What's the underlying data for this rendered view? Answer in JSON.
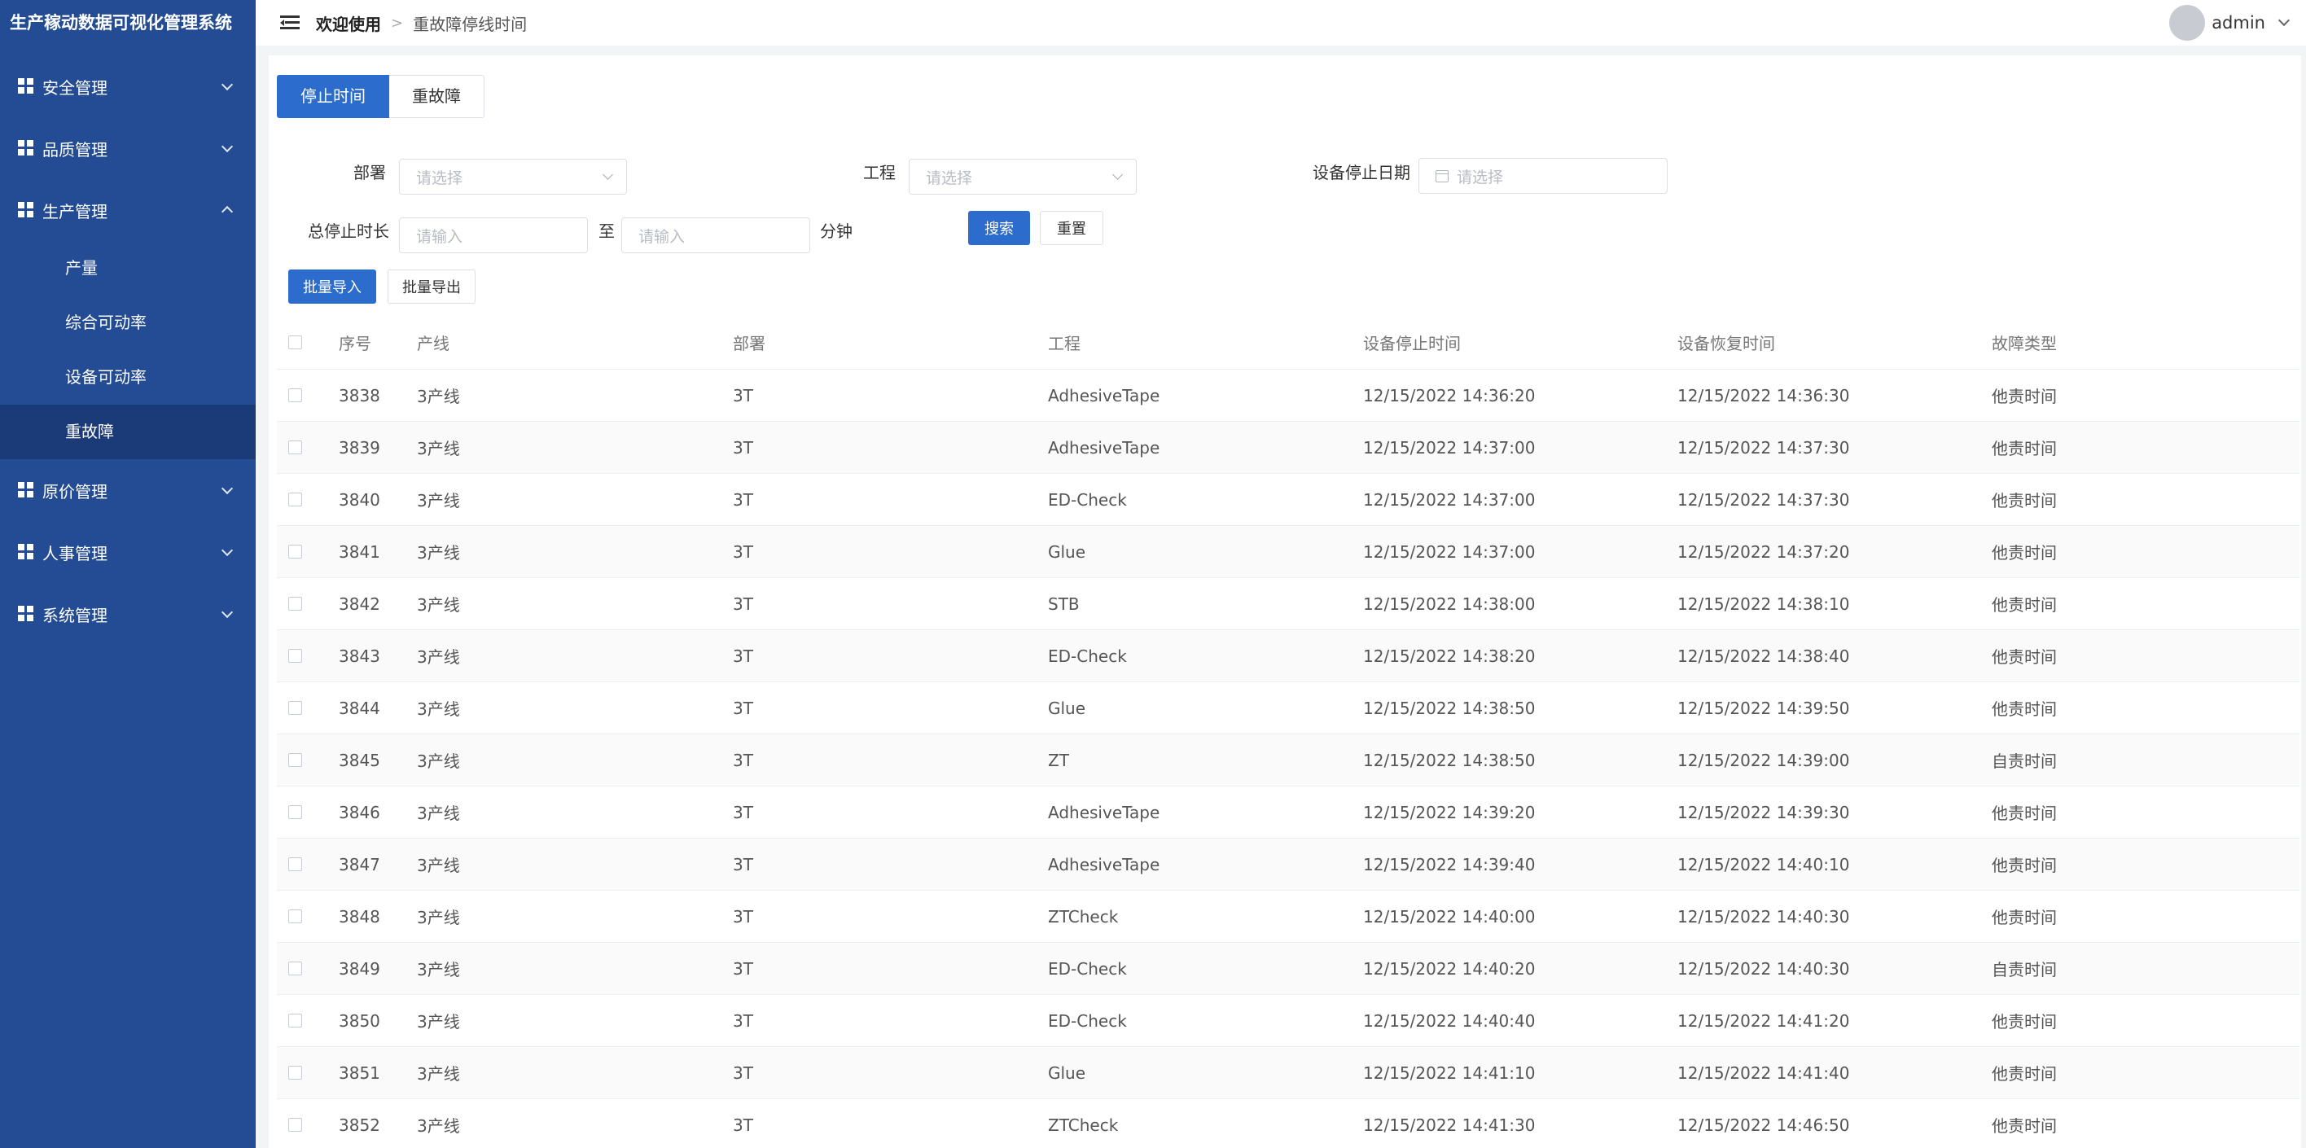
{
  "app": {
    "title": "生产稼动数据可视化管理系统"
  },
  "sidebar": {
    "groups": [
      {
        "label": "安全管理",
        "expanded": false
      },
      {
        "label": "品质管理",
        "expanded": false
      },
      {
        "label": "生产管理",
        "expanded": true,
        "children": [
          "产量",
          "综合可动率",
          "设备可动率",
          "重故障"
        ],
        "active_child": "重故障"
      },
      {
        "label": "原价管理",
        "expanded": false
      },
      {
        "label": "人事管理",
        "expanded": false
      },
      {
        "label": "系统管理",
        "expanded": false
      }
    ]
  },
  "header": {
    "breadcrumb_home": "欢迎使用",
    "breadcrumb_separator": ">",
    "breadcrumb_current": "重故障停线时间",
    "username": "admin"
  },
  "tabs": [
    "停止时间",
    "重故障"
  ],
  "filters": {
    "department_label": "部署",
    "department_placeholder": "请选择",
    "process_label": "工程",
    "process_placeholder": "请选择",
    "stop_date_label": "设备停止日期",
    "stop_date_placeholder": "请选择",
    "duration_label": "总停止时长",
    "duration_from_placeholder": "请输入",
    "duration_to_label": "至",
    "duration_to_placeholder": "请输入",
    "duration_unit": "分钟",
    "search_button": "搜索",
    "reset_button": "重置"
  },
  "actions": {
    "import_button": "批量导入",
    "export_button": "批量导出"
  },
  "table": {
    "columns": [
      "序号",
      "产线",
      "部署",
      "工程",
      "设备停止时间",
      "设备恢复时间",
      "故障类型"
    ],
    "rows": [
      [
        "3838",
        "3产线",
        "3T",
        "AdhesiveTape",
        "12/15/2022 14:36:20",
        "12/15/2022 14:36:30",
        "他责时间"
      ],
      [
        "3839",
        "3产线",
        "3T",
        "AdhesiveTape",
        "12/15/2022 14:37:00",
        "12/15/2022 14:37:30",
        "他责时间"
      ],
      [
        "3840",
        "3产线",
        "3T",
        "ED-Check",
        "12/15/2022 14:37:00",
        "12/15/2022 14:37:30",
        "他责时间"
      ],
      [
        "3841",
        "3产线",
        "3T",
        "Glue",
        "12/15/2022 14:37:00",
        "12/15/2022 14:37:20",
        "他责时间"
      ],
      [
        "3842",
        "3产线",
        "3T",
        "STB",
        "12/15/2022 14:38:00",
        "12/15/2022 14:38:10",
        "他责时间"
      ],
      [
        "3843",
        "3产线",
        "3T",
        "ED-Check",
        "12/15/2022 14:38:20",
        "12/15/2022 14:38:40",
        "他责时间"
      ],
      [
        "3844",
        "3产线",
        "3T",
        "Glue",
        "12/15/2022 14:38:50",
        "12/15/2022 14:39:50",
        "他责时间"
      ],
      [
        "3845",
        "3产线",
        "3T",
        "ZT",
        "12/15/2022 14:38:50",
        "12/15/2022 14:39:00",
        "自责时间"
      ],
      [
        "3846",
        "3产线",
        "3T",
        "AdhesiveTape",
        "12/15/2022 14:39:20",
        "12/15/2022 14:39:30",
        "他责时间"
      ],
      [
        "3847",
        "3产线",
        "3T",
        "AdhesiveTape",
        "12/15/2022 14:39:40",
        "12/15/2022 14:40:10",
        "他责时间"
      ],
      [
        "3848",
        "3产线",
        "3T",
        "ZTCheck",
        "12/15/2022 14:40:00",
        "12/15/2022 14:40:30",
        "他责时间"
      ],
      [
        "3849",
        "3产线",
        "3T",
        "ED-Check",
        "12/15/2022 14:40:20",
        "12/15/2022 14:40:30",
        "自责时间"
      ],
      [
        "3850",
        "3产线",
        "3T",
        "ED-Check",
        "12/15/2022 14:40:40",
        "12/15/2022 14:41:20",
        "他责时间"
      ],
      [
        "3851",
        "3产线",
        "3T",
        "Glue",
        "12/15/2022 14:41:10",
        "12/15/2022 14:41:40",
        "他责时间"
      ],
      [
        "3852",
        "3产线",
        "3T",
        "ZTCheck",
        "12/15/2022 14:41:30",
        "12/15/2022 14:46:50",
        "他责时间"
      ]
    ]
  },
  "colors": {
    "sidebar_bg": "#234c94",
    "sidebar_active_bg": "#1b3a78",
    "primary": "#2c6ccc"
  }
}
